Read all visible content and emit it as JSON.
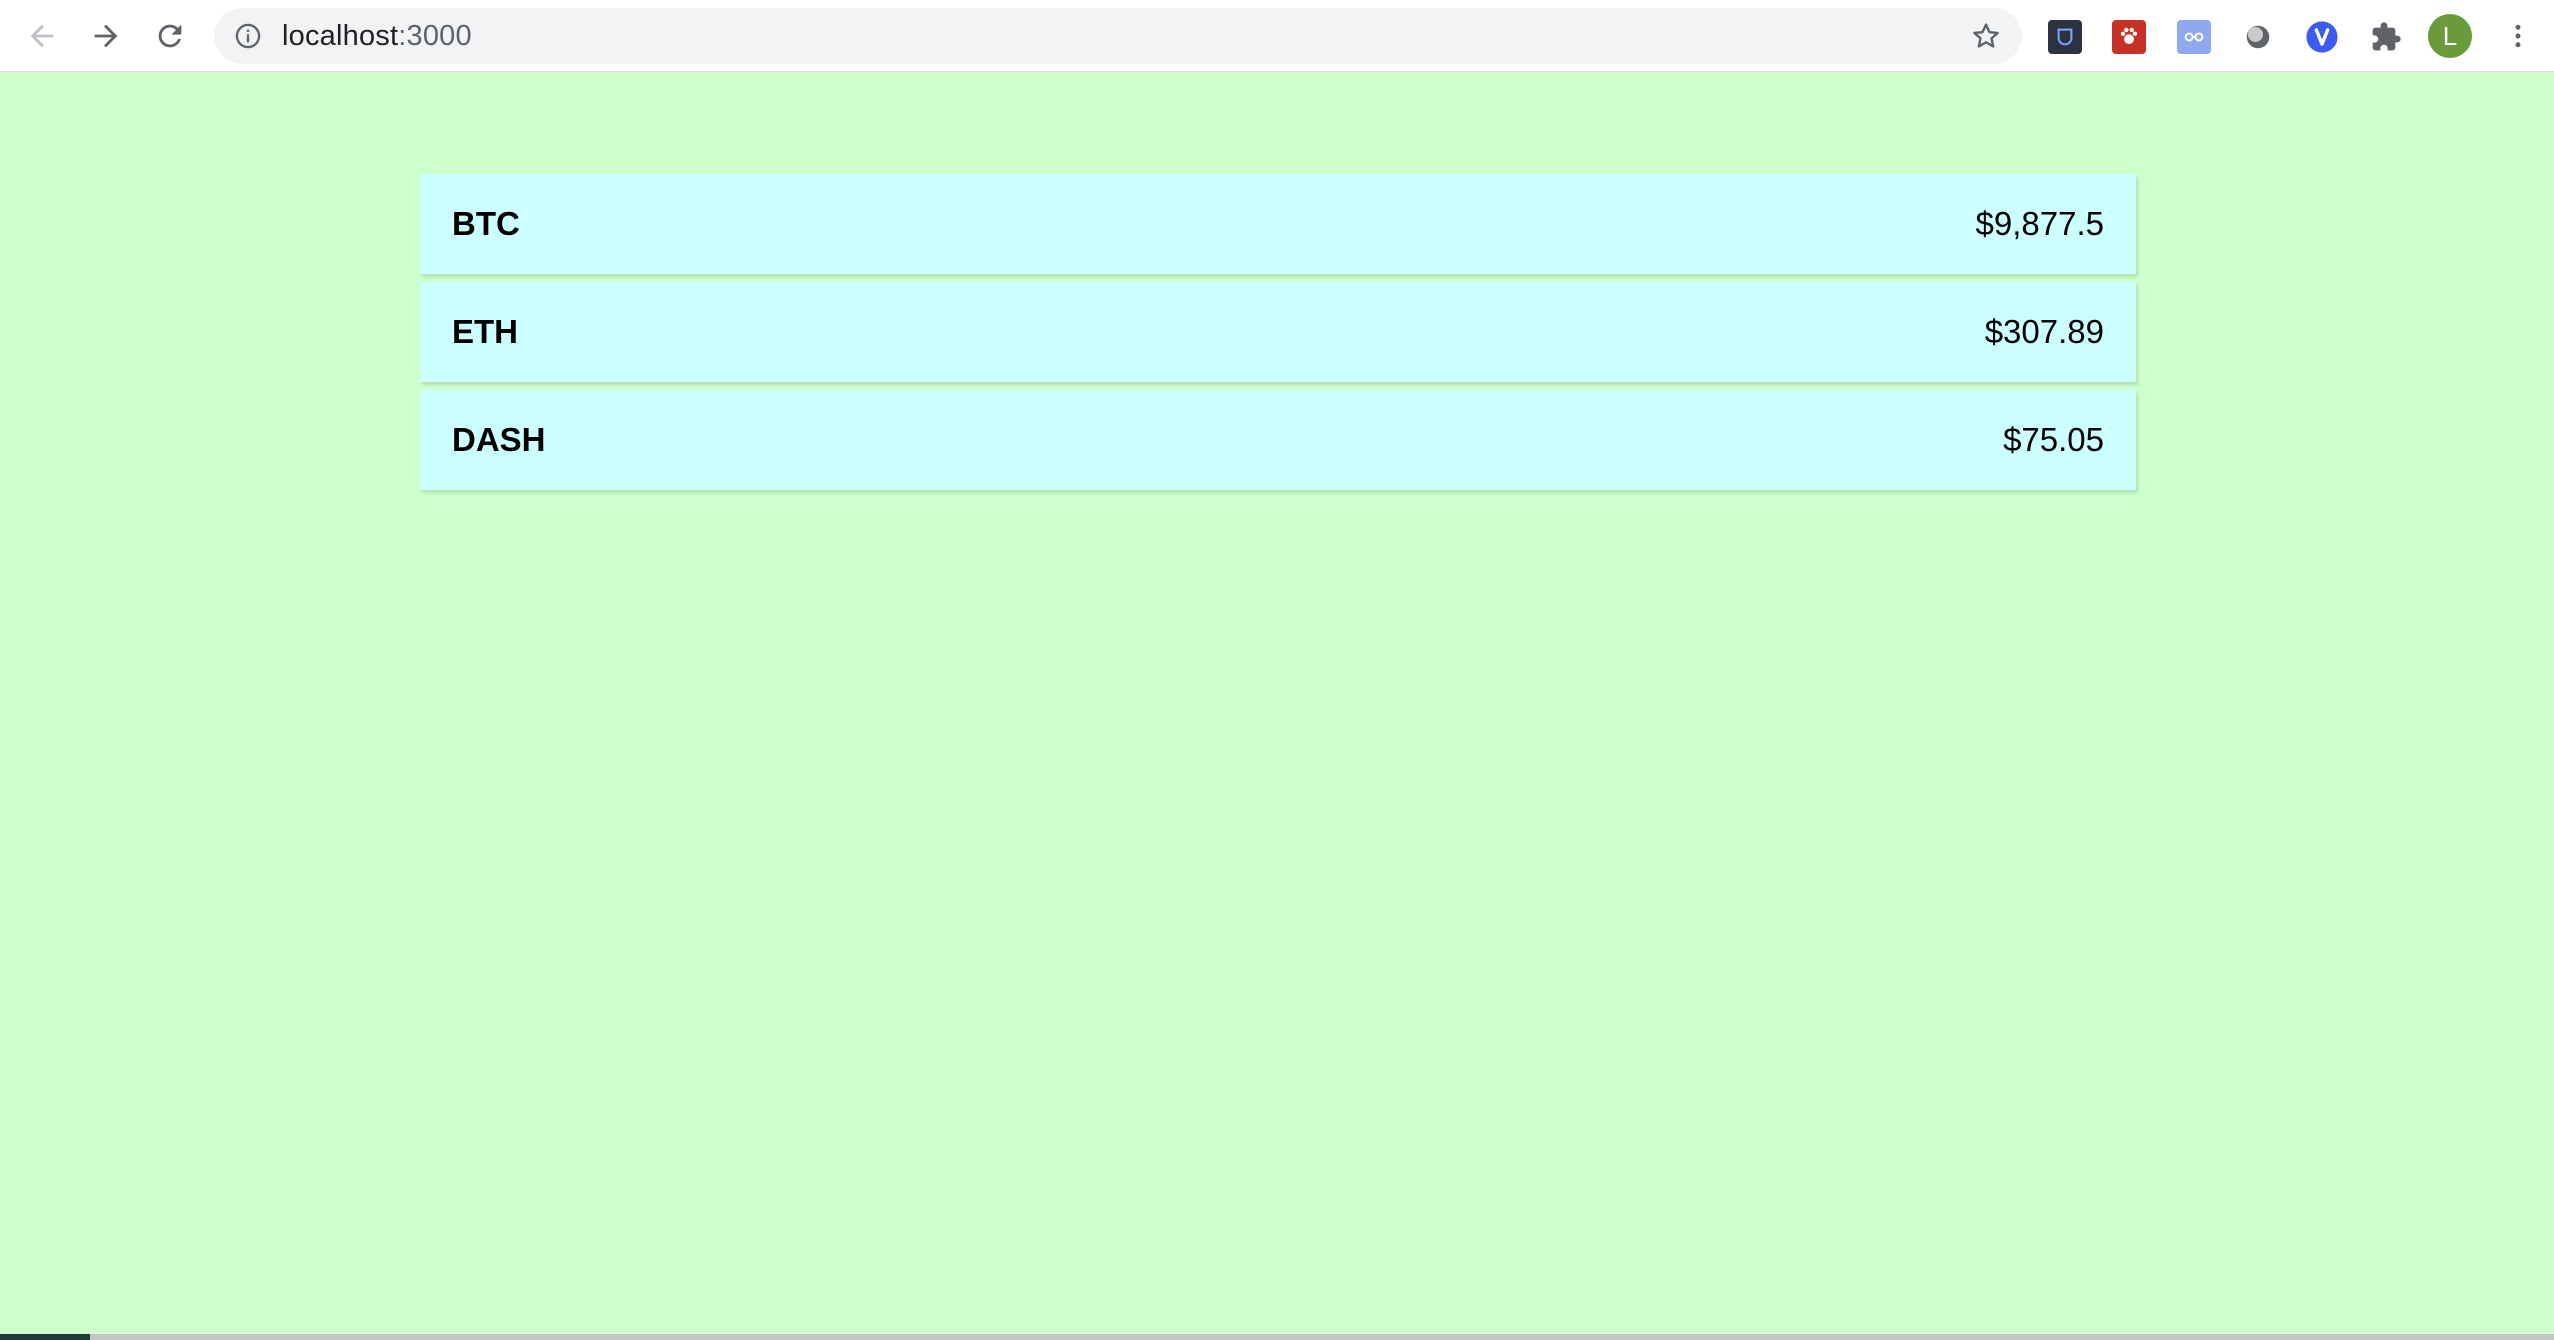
{
  "browser": {
    "url_host": "localhost",
    "url_port": ":3000",
    "avatar_letter": "L",
    "icons": {
      "back": "arrow-left-icon",
      "forward": "arrow-right-icon",
      "reload": "reload-icon",
      "info": "info-icon",
      "bookmark": "star-icon",
      "extensions": "puzzle-icon",
      "menu": "kebab-menu-icon"
    }
  },
  "theme": {
    "page_background": "#ccffcc",
    "row_background": "#ccffff"
  },
  "coins": [
    {
      "symbol": "BTC",
      "price": "$9,877.5"
    },
    {
      "symbol": "ETH",
      "price": "$307.89"
    },
    {
      "symbol": "DASH",
      "price": "$75.05"
    }
  ]
}
